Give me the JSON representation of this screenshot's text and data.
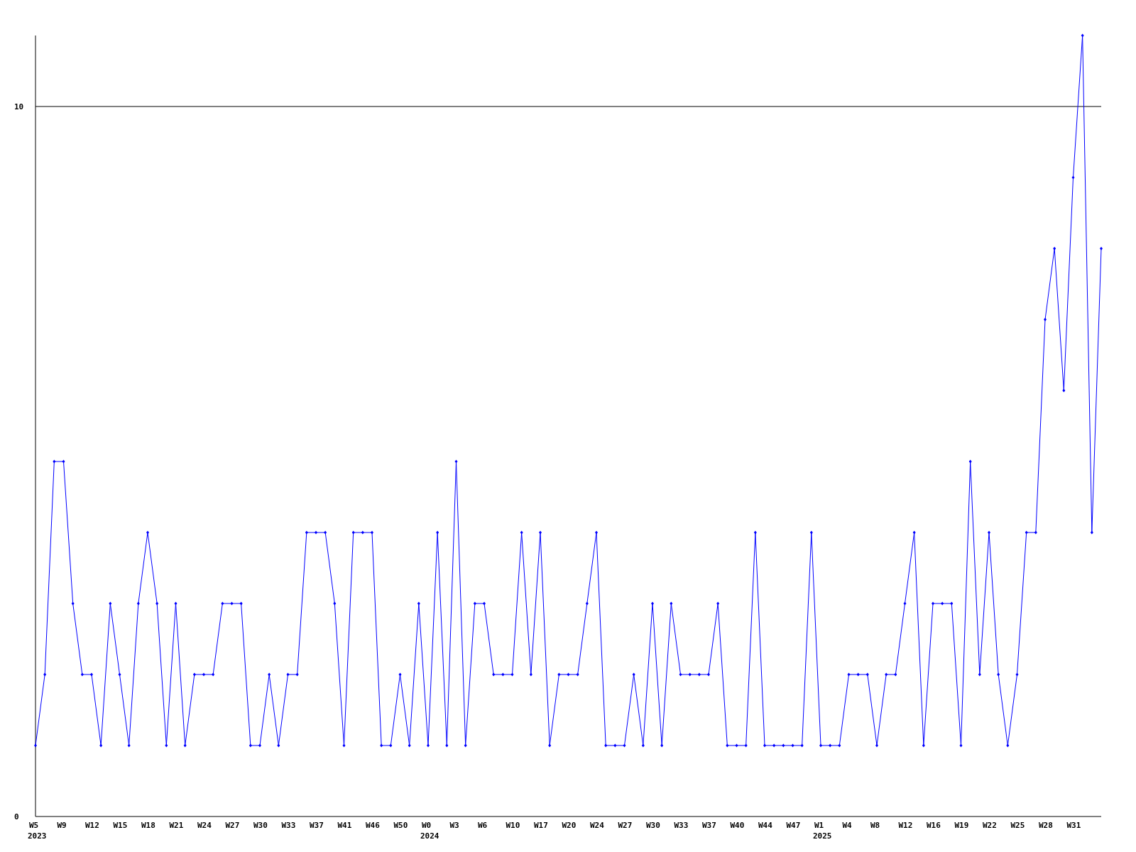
{
  "chart_data": {
    "type": "line",
    "categories": [
      "W5",
      null,
      null,
      "W9",
      null,
      null,
      "W12",
      null,
      null,
      "W15",
      null,
      null,
      "W18",
      null,
      null,
      "W21",
      null,
      null,
      "W24",
      null,
      null,
      "W27",
      null,
      null,
      "W30",
      null,
      null,
      "W33",
      null,
      null,
      "W37",
      null,
      null,
      "W41",
      null,
      null,
      "W46",
      null,
      null,
      "W50",
      null,
      null,
      "W0",
      null,
      null,
      "W3",
      null,
      null,
      "W6",
      null,
      null,
      "W10",
      null,
      null,
      "W17",
      null,
      null,
      "W20",
      null,
      null,
      "W24",
      null,
      null,
      "W27",
      null,
      null,
      "W30",
      null,
      null,
      "W33",
      null,
      null,
      "W37",
      null,
      null,
      "W40",
      null,
      null,
      "W44",
      null,
      null,
      "W47",
      null,
      null,
      "W1",
      null,
      null,
      "W4",
      null,
      null,
      "W8",
      null,
      null,
      "W12",
      null,
      null,
      "W16",
      null,
      null,
      "W19",
      null,
      null,
      "W22",
      null,
      null,
      "W25",
      null,
      null,
      "W28",
      null,
      null,
      "W31",
      null,
      null,
      null
    ],
    "series": [
      {
        "color": "#0000ff",
        "marker": "diamond",
        "values": [
          1,
          2,
          5,
          5,
          3,
          2,
          2,
          1,
          3,
          2,
          1,
          3,
          4,
          3,
          1,
          3,
          1,
          2,
          2,
          2,
          3,
          3,
          3,
          1,
          1,
          2,
          1,
          2,
          2,
          4,
          4,
          4,
          3,
          1,
          4,
          4,
          4,
          1,
          1,
          2,
          1,
          3,
          1,
          4,
          1,
          5,
          1,
          3,
          3,
          2,
          2,
          2,
          4,
          2,
          4,
          1,
          2,
          2,
          2,
          3,
          4,
          1,
          1,
          1,
          2,
          1,
          3,
          1,
          3,
          2,
          2,
          2,
          2,
          3,
          1,
          1,
          1,
          4,
          1,
          1,
          1,
          1,
          1,
          4,
          1,
          1,
          1,
          2,
          2,
          2,
          1,
          2,
          2,
          3,
          4,
          1,
          3,
          3,
          3,
          1,
          5,
          2,
          4,
          2,
          1,
          2,
          4,
          4,
          7,
          8,
          6,
          9,
          11,
          4,
          8
        ]
      }
    ],
    "ylim": [
      0,
      11
    ],
    "yticks": [
      0,
      10
    ],
    "annotations": [
      "2023",
      "2024",
      "2025"
    ]
  }
}
